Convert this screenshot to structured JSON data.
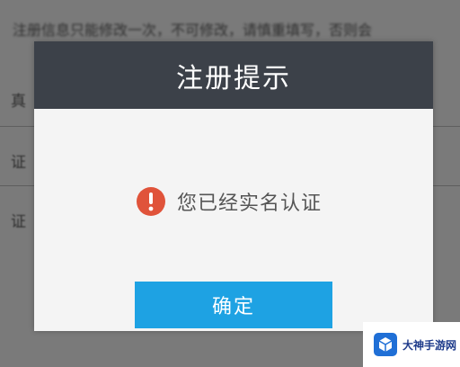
{
  "background": {
    "notice_text": "注册信息只能修改一次，不可修改，请慎重填写，否则会",
    "label_1": "真",
    "label_2": "证",
    "label_3": "证"
  },
  "dialog": {
    "title": "注册提示",
    "message": "您已经实名认证",
    "message_icon": "alert-icon",
    "confirm_label": "确定"
  },
  "watermark": {
    "text": "大神手游网",
    "logo_icon": "cube-logo-icon"
  },
  "colors": {
    "header_bg": "#3c4149",
    "confirm_bg": "#1ea2e3",
    "alert": "#e0533a",
    "overlay": "#7a7a7a"
  }
}
